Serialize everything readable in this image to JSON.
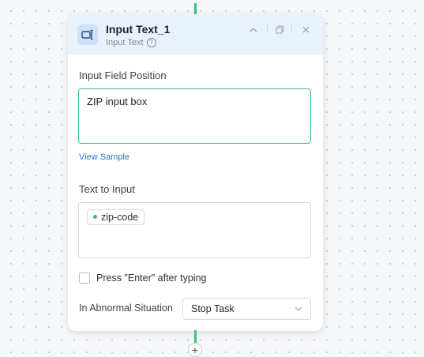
{
  "node": {
    "title": "Input Text_1",
    "subtitle": "Input Text"
  },
  "header_buttons": {
    "collapse_icon": "chevron-up-icon",
    "copy_icon": "copy-icon",
    "close_icon": "close-icon"
  },
  "fields": {
    "input_position_label": "Input Field Position",
    "input_position_value": "ZIP input box",
    "view_sample": "View Sample",
    "text_to_input_label": "Text to Input",
    "text_to_input_chip": "zip-code",
    "press_enter_label": "Press \"Enter\" after typing",
    "press_enter_checked": false,
    "abnormal_label": "In Abnormal Situation",
    "abnormal_value": "Stop Task"
  },
  "colors": {
    "accent_green": "#35c27a",
    "link_blue": "#2f6fd8",
    "header_bg": "#e9f1fd"
  },
  "canvas": {
    "add_node_icon": "plus-icon"
  }
}
